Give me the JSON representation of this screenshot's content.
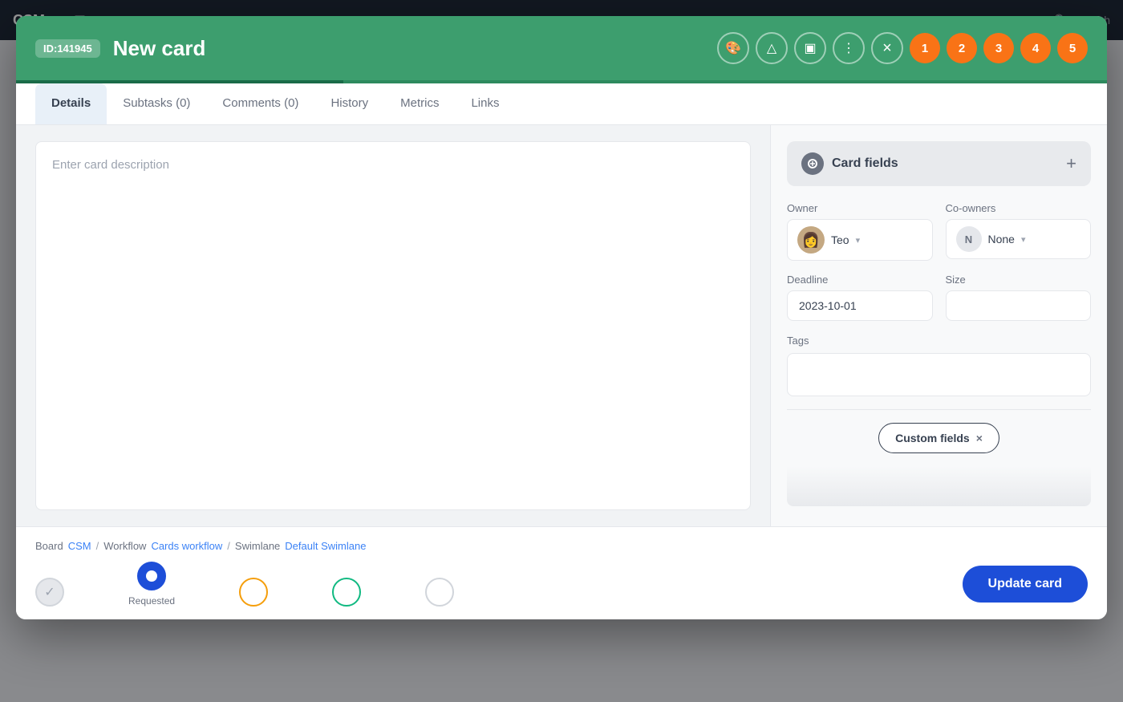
{
  "nav": {
    "brand": "CSM",
    "search_placeholder": "Search"
  },
  "modal": {
    "card_id": "ID:141945",
    "card_title": "New card",
    "close_btn_label": "×",
    "header_avatars": [
      "1",
      "2",
      "3",
      "4",
      "5"
    ]
  },
  "tabs": [
    {
      "id": "details",
      "label": "Details",
      "active": true
    },
    {
      "id": "subtasks",
      "label": "Subtasks (0)",
      "active": false
    },
    {
      "id": "comments",
      "label": "Comments (0)",
      "active": false
    },
    {
      "id": "history",
      "label": "History",
      "active": false
    },
    {
      "id": "metrics",
      "label": "Metrics",
      "active": false
    },
    {
      "id": "links",
      "label": "Links",
      "active": false
    }
  ],
  "description": {
    "placeholder": "Enter card description"
  },
  "card_fields": {
    "title": "Card fields",
    "add_btn": "+",
    "owner_label": "Owner",
    "owner_name": "Teo",
    "owner_chevron": "▾",
    "coowners_label": "Co-owners",
    "coowner_letter": "N",
    "coowner_name": "None",
    "coowner_chevron": "▾",
    "deadline_label": "Deadline",
    "deadline_value": "2023-10-01",
    "size_label": "Size",
    "size_value": "",
    "tags_label": "Tags",
    "custom_fields_label": "Custom fields",
    "custom_fields_close": "×"
  },
  "footer": {
    "board_label": "Board",
    "board_link": "CSM",
    "workflow_label": "Workflow",
    "workflow_link": "Cards workflow",
    "swimlane_label": "Swimlane",
    "swimlane_link": "Default Swimlane",
    "sep": "/"
  },
  "status_steps": [
    {
      "id": "done",
      "type": "completed",
      "label": ""
    },
    {
      "id": "requested",
      "type": "active",
      "label": "Requested"
    },
    {
      "id": "step3",
      "type": "pending-orange",
      "label": ""
    },
    {
      "id": "step4",
      "type": "pending-green",
      "label": ""
    },
    {
      "id": "step5",
      "type": "pending-light",
      "label": ""
    }
  ],
  "update_btn": "Update card"
}
